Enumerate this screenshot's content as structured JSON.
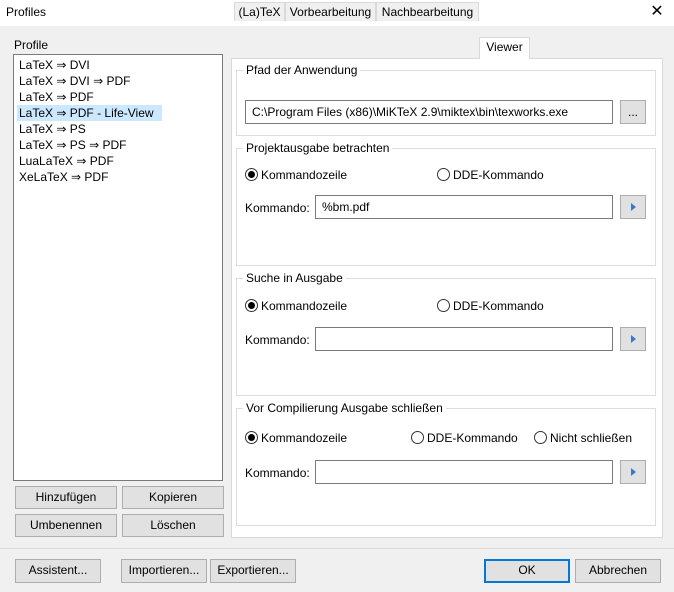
{
  "window": {
    "title": "Profiles"
  },
  "profiles": {
    "label": "Profile",
    "items": [
      "LaTeX ⇒ DVI",
      "LaTeX ⇒ DVI ⇒ PDF",
      "LaTeX ⇒ PDF",
      "LaTeX ⇒ PDF - Life-View",
      "LaTeX ⇒ PS",
      "LaTeX ⇒ PS ⇒ PDF",
      "LuaLaTeX ⇒ PDF",
      "XeLaTeX ⇒ PDF"
    ],
    "selected_index": 3,
    "buttons": {
      "add": "Hinzufügen",
      "copy": "Kopieren",
      "rename": "Umbenennen",
      "delete": "Löschen"
    }
  },
  "tabs": [
    "(La)TeX",
    "Vorbearbeitung",
    "Nachbearbeitung",
    "Viewer"
  ],
  "active_tab": "Viewer",
  "viewer": {
    "app_path": {
      "title": "Pfad der Anwendung",
      "value": "C:\\Program Files (x86)\\MiKTeX 2.9\\miktex\\bin\\texworks.exe",
      "browse_label": "..."
    },
    "view_output": {
      "title": "Projektausgabe betrachten",
      "radio_cmdline": "Kommandozeile",
      "radio_dde": "DDE-Kommando",
      "selected": "Kommandozeile",
      "command_label": "Kommando:",
      "command_value": "%bm.pdf"
    },
    "search_output": {
      "title": "Suche in Ausgabe",
      "radio_cmdline": "Kommandozeile",
      "radio_dde": "DDE-Kommando",
      "selected": "Kommandozeile",
      "command_label": "Kommando:",
      "command_value": ""
    },
    "close_before_compile": {
      "title": "Vor Compilierung Ausgabe schließen",
      "radio_cmdline": "Kommandozeile",
      "radio_dde": "DDE-Kommando",
      "radio_no_close": "Nicht schließen",
      "selected": "Kommandozeile",
      "command_label": "Kommando:",
      "command_value": ""
    }
  },
  "footer": {
    "wizard": "Assistent...",
    "import": "Importieren...",
    "export": "Exportieren...",
    "ok": "OK",
    "cancel": "Abbrechen"
  }
}
